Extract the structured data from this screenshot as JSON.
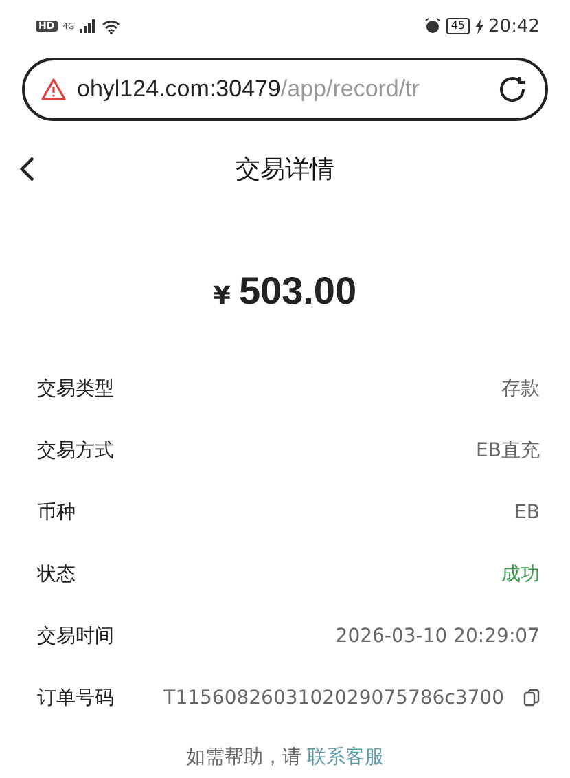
{
  "status_bar": {
    "left": [
      "HD",
      "4G"
    ],
    "battery": "45",
    "time": "20:42"
  },
  "address_bar": {
    "host": "ohyl124.com:30479",
    "path": "/app/record/tr"
  },
  "header": {
    "title": "交易详情"
  },
  "amount": {
    "currency": "¥",
    "value": "503.00"
  },
  "rows": [
    {
      "label": "交易类型",
      "value": "存款",
      "kind": "plain"
    },
    {
      "label": "交易方式",
      "value": "EB直充",
      "kind": "plain"
    },
    {
      "label": "币种",
      "value": "EB",
      "kind": "plain"
    },
    {
      "label": "状态",
      "value": "成功",
      "kind": "status"
    },
    {
      "label": "交易时间",
      "value": "2026-03-10 20:29:07",
      "kind": "plain"
    },
    {
      "label": "订单号码",
      "value": "T1156082603102029075786c3700",
      "kind": "copy"
    }
  ],
  "help": {
    "text": "如需帮助，请 ",
    "link": "联系客服"
  }
}
